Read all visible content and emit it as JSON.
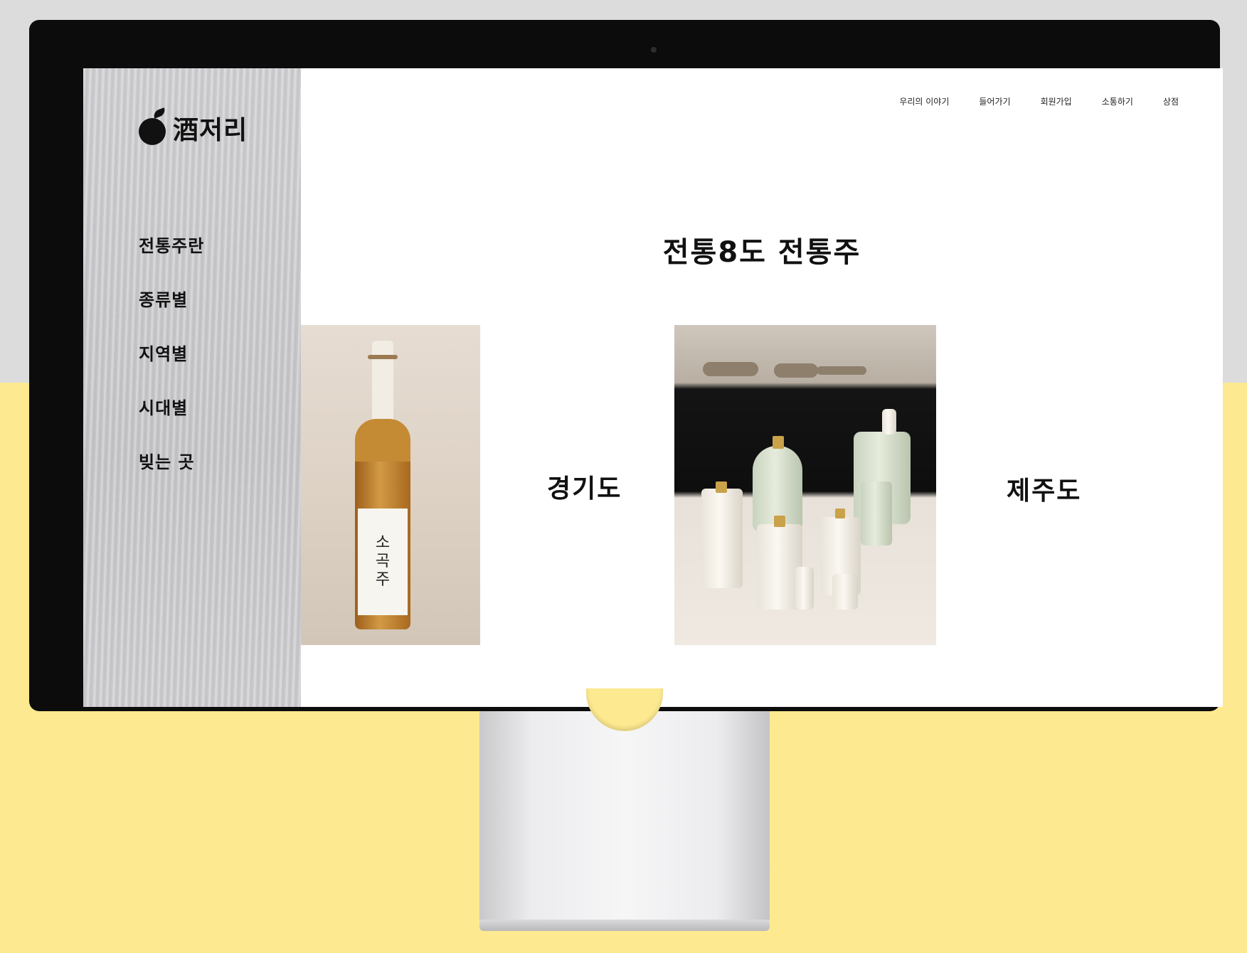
{
  "brand": {
    "logo_text": "酒저리"
  },
  "sidebar": {
    "items": [
      {
        "label": "전통주란"
      },
      {
        "label": "종류별"
      },
      {
        "label": "지역별"
      },
      {
        "label": "시대별"
      },
      {
        "label": "빚는 곳"
      }
    ]
  },
  "top_nav": {
    "items": [
      {
        "label": "우리의 이야기"
      },
      {
        "label": "들어가기"
      },
      {
        "label": "회원가입"
      },
      {
        "label": "소통하기"
      },
      {
        "label": "상점"
      }
    ]
  },
  "main": {
    "title": "전통8도 전통주",
    "regions": [
      {
        "label": "경기도"
      },
      {
        "label": "제주도"
      }
    ],
    "photo1": {
      "bottle_label_line1": "소",
      "bottle_label_line2": "곡",
      "bottle_label_line3": "주"
    }
  },
  "colors": {
    "background_top": "#dcdcdd",
    "background_bottom": "#fde98f",
    "monitor_bezel": "#0c0c0c",
    "sidebar": "#cbcbce",
    "text": "#111111"
  },
  "icons": {
    "logo": "apple-icon"
  }
}
